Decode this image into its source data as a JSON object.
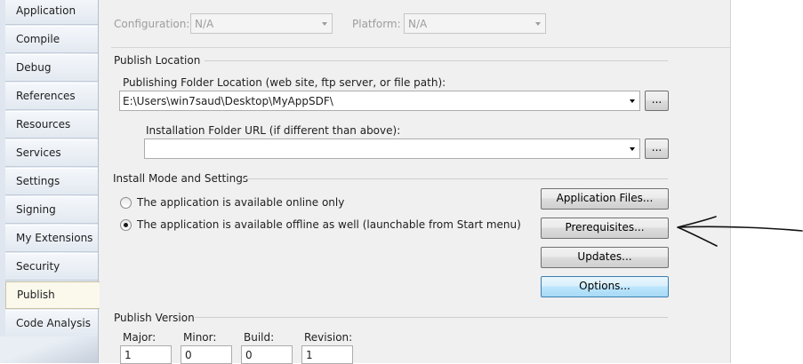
{
  "sidebar": {
    "items": [
      {
        "label": "Application"
      },
      {
        "label": "Compile"
      },
      {
        "label": "Debug"
      },
      {
        "label": "References"
      },
      {
        "label": "Resources"
      },
      {
        "label": "Services"
      },
      {
        "label": "Settings"
      },
      {
        "label": "Signing"
      },
      {
        "label": "My Extensions"
      },
      {
        "label": "Security"
      },
      {
        "label": "Publish"
      },
      {
        "label": "Code Analysis"
      }
    ],
    "selected": "Publish"
  },
  "config_bar": {
    "configuration_label": "Configuration:",
    "configuration_value": "N/A",
    "platform_label": "Platform:",
    "platform_value": "N/A"
  },
  "publish_location": {
    "section_title": "Publish Location",
    "folder_label": "Publishing Folder Location (web site, ftp server, or file path):",
    "folder_value": "E:\\Users\\win7saud\\Desktop\\MyAppSDF\\",
    "install_url_label": "Installation Folder URL (if different than above):",
    "install_url_value": "",
    "browse_label": "..."
  },
  "install_mode": {
    "section_title": "Install Mode and Settings",
    "option_online": "The application is available online only",
    "option_offline": "The application is available offline as well (launchable from Start menu)",
    "selected": "offline",
    "buttons": {
      "application_files": "Application Files...",
      "prerequisites": "Prerequisites...",
      "updates": "Updates...",
      "options": "Options..."
    }
  },
  "publish_version": {
    "section_title": "Publish Version",
    "major_label": "Major:",
    "major_value": "1",
    "minor_label": "Minor:",
    "minor_value": "0",
    "build_label": "Build:",
    "build_value": "0",
    "revision_label": "Revision:",
    "revision_value": "1"
  },
  "colors": {
    "panel_bg": "#f0f0f0",
    "selected_tab_bg": "#fbf9ec",
    "focus_button": "#bee6fd"
  }
}
